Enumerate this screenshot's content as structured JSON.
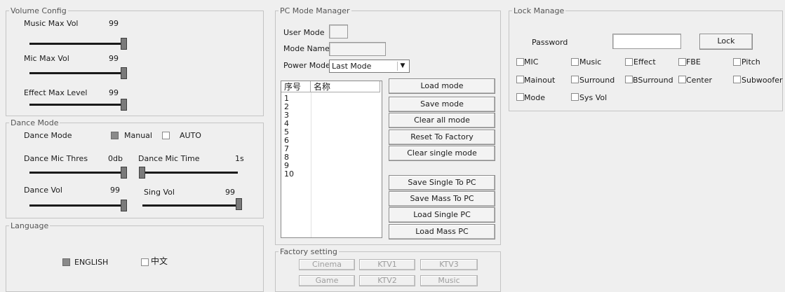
{
  "volume_config": {
    "title": "Volume Config",
    "music_label": "Music Max Vol",
    "music_value": "99",
    "mic_label": "Mic Max Vol",
    "mic_value": "99",
    "effect_label": "Effect Max Level",
    "effect_value": "99",
    "music_level": 1.0,
    "mic_level": 1.0,
    "effect_level": 1.0
  },
  "dance_mode": {
    "title": "Dance Mode",
    "mode_label": "Dance Mode",
    "manual_label": "Manual",
    "auto_label": "AUTO",
    "manual_checked": true,
    "auto_checked": false,
    "thres_label": "Dance Mic Thres",
    "thres_value": "0db",
    "time_label": "Dance Mic Time",
    "time_value": "1s",
    "vol_label": "Dance Vol",
    "vol_value": "99",
    "sing_label": "Sing Vol",
    "sing_value": "99",
    "thres_level": 1.0,
    "time_level": 0.0,
    "vol_level": 1.0,
    "sing_level": 1.0
  },
  "language": {
    "title": "Language",
    "english_label": "ENGLISH",
    "chinese_label": "中文",
    "english_checked": true,
    "chinese_checked": false
  },
  "pc_mode": {
    "title": "PC Mode Manager",
    "user_mode_label": "User Mode",
    "mode_name_label": "Mode Name",
    "power_mode_label": "Power Mode",
    "power_mode_value": "Last Mode",
    "list_headers": [
      "序号",
      "名称"
    ],
    "list_rows": [
      "1",
      "2",
      "3",
      "4",
      "5",
      "6",
      "7",
      "8",
      "9",
      "10"
    ],
    "buttons": {
      "load_mode": "Load mode",
      "save_mode": "Save mode",
      "clear_all": "Clear all mode",
      "reset_factory": "Reset To Factory",
      "clear_single": "Clear single mode",
      "save_single_pc": "Save Single To PC",
      "save_mass_pc": "Save Mass To PC",
      "load_single_pc": "Load Single PC",
      "load_mass_pc": "Load Mass PC"
    }
  },
  "factory_setting": {
    "title": "Factory setting",
    "buttons": [
      "Cinema",
      "KTV1",
      "KTV3",
      "Game",
      "KTV2",
      "Music"
    ]
  },
  "lock_manage": {
    "title": "Lock Manage",
    "password_label": "Password",
    "password_value": "",
    "lock_button": "Lock",
    "checkboxes": [
      "MIC",
      "Music",
      "Effect",
      "FBE",
      "Pitch",
      "Mainout",
      "Surround",
      "BSurround",
      "Center",
      "Subwoofer",
      "Mode",
      "Sys Vol"
    ]
  },
  "colors": {
    "window_bg": "#efefef",
    "group_border": "#c4c4c4",
    "slider_thumb": "#7a7a7a",
    "checked_fill": "#8a8a8a"
  }
}
